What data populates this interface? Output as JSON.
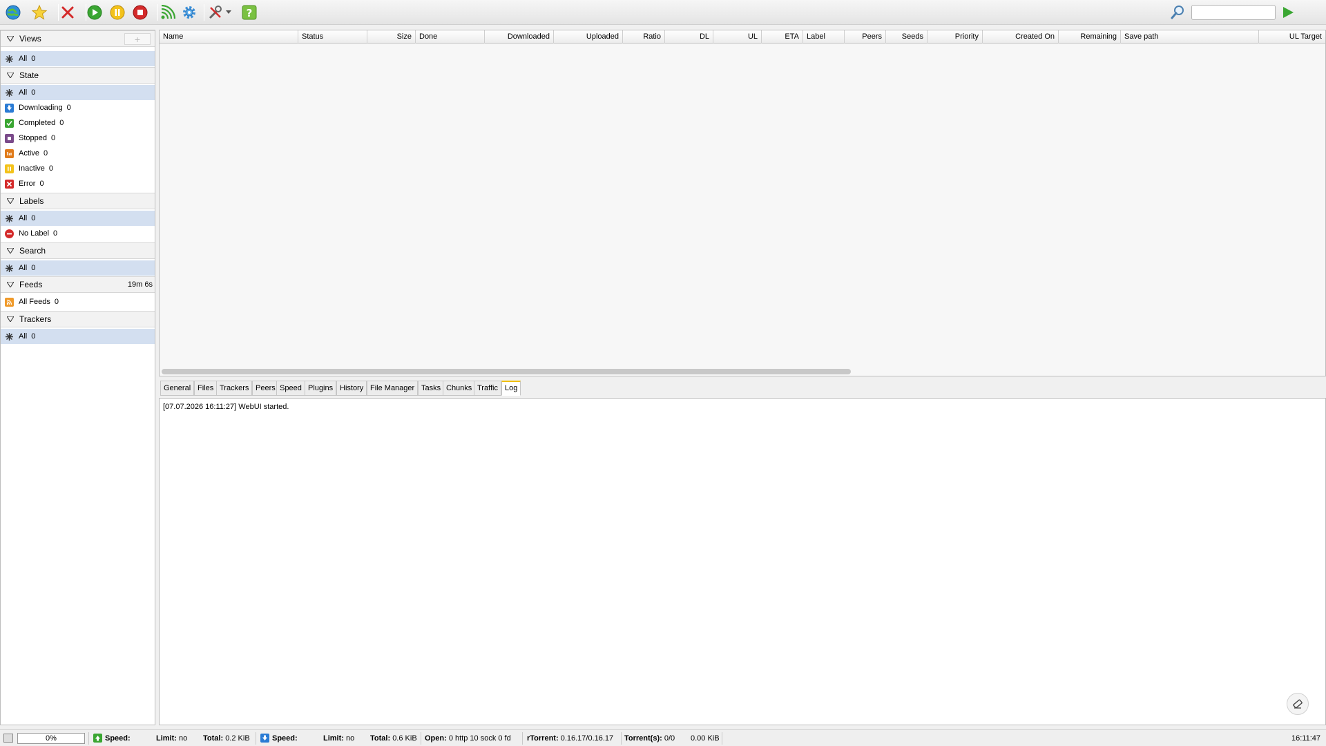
{
  "toolbar": {
    "search_placeholder": ""
  },
  "sidebar": {
    "views": {
      "title": "Views",
      "add_label": "+",
      "items": [
        {
          "label": "All",
          "count": "0"
        }
      ]
    },
    "state": {
      "title": "State",
      "items": [
        {
          "label": "All",
          "count": "0"
        },
        {
          "label": "Downloading",
          "count": "0"
        },
        {
          "label": "Completed",
          "count": "0"
        },
        {
          "label": "Stopped",
          "count": "0"
        },
        {
          "label": "Active",
          "count": "0"
        },
        {
          "label": "Inactive",
          "count": "0"
        },
        {
          "label": "Error",
          "count": "0"
        }
      ]
    },
    "labels": {
      "title": "Labels",
      "items": [
        {
          "label": "All",
          "count": "0"
        },
        {
          "label": "No Label",
          "count": "0"
        }
      ]
    },
    "search": {
      "title": "Search",
      "items": [
        {
          "label": "All",
          "count": "0"
        }
      ]
    },
    "feeds": {
      "title": "Feeds",
      "extra": "19m 6s",
      "items": [
        {
          "label": "All Feeds",
          "count": "0"
        }
      ]
    },
    "trackers": {
      "title": "Trackers",
      "items": [
        {
          "label": "All",
          "count": "0"
        }
      ]
    }
  },
  "table": {
    "columns": [
      "Name",
      "Status",
      "Size",
      "Done",
      "Downloaded",
      "Uploaded",
      "Ratio",
      "DL",
      "UL",
      "ETA",
      "Label",
      "Peers",
      "Seeds",
      "Priority",
      "Created On",
      "Remaining",
      "Save path",
      "UL Target"
    ]
  },
  "tabs": [
    "General",
    "Files",
    "Trackers",
    "Peers",
    "Speed",
    "Plugins",
    "History",
    "File Manager",
    "Tasks",
    "Chunks",
    "Traffic",
    "Log"
  ],
  "active_tab": "Log",
  "log": {
    "line": "[07.07.2026 16:11:27] WebUI started."
  },
  "statusbar": {
    "progress": "0%",
    "up_speed_label": "Speed:",
    "up_limit_label": "Limit:",
    "up_limit_value": "no",
    "up_total_label": "Total:",
    "up_total_value": "0.2 KiB",
    "down_speed_label": "Speed:",
    "down_limit_label": "Limit:",
    "down_limit_value": "no",
    "down_total_label": "Total:",
    "down_total_value": "0.6 KiB",
    "open_label": "Open:",
    "open_value": "0 http 10 sock 0 fd",
    "rtorrent_label": "rTorrent:",
    "rtorrent_value": "0.16.17/0.16.17",
    "torrents_label": "Torrent(s):",
    "torrents_value": "0/0",
    "disk_value": "0.00 KiB",
    "clock": "16:11:47"
  },
  "colors": {
    "selected_row": "#d3dff0",
    "active_tab_accent": "#f0c000",
    "green_icon": "#3aa632",
    "blue_icon": "#2a7bd4",
    "red_icon": "#d42a2a"
  }
}
